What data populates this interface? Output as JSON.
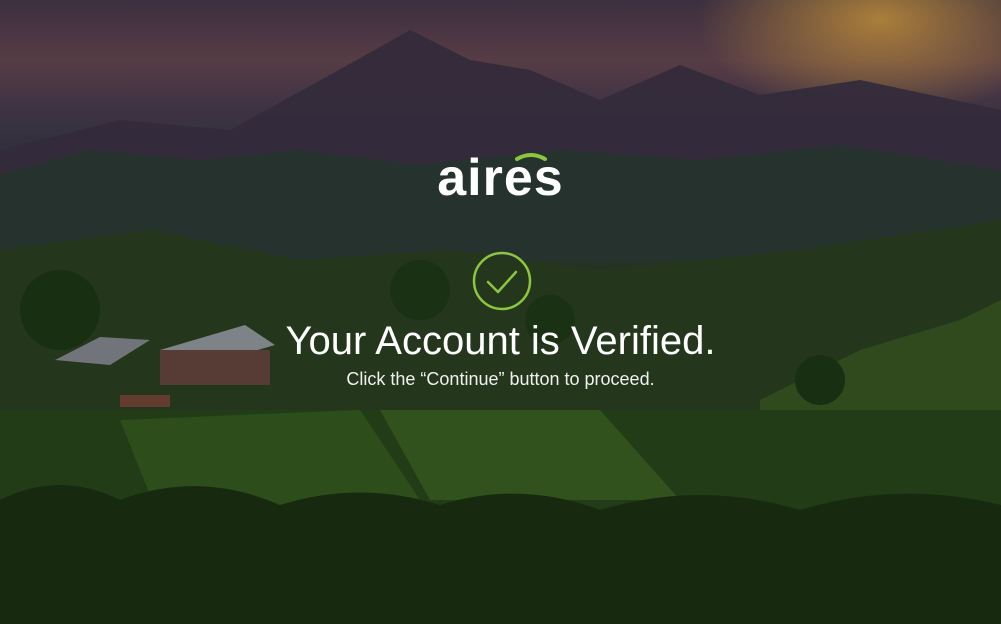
{
  "brand": {
    "name": "aires",
    "accent_color": "#8cc63f"
  },
  "status": {
    "icon": "check-circle-icon",
    "title": "Your Account is Verified.",
    "subtitle": "Click the “Continue” button to proceed."
  }
}
